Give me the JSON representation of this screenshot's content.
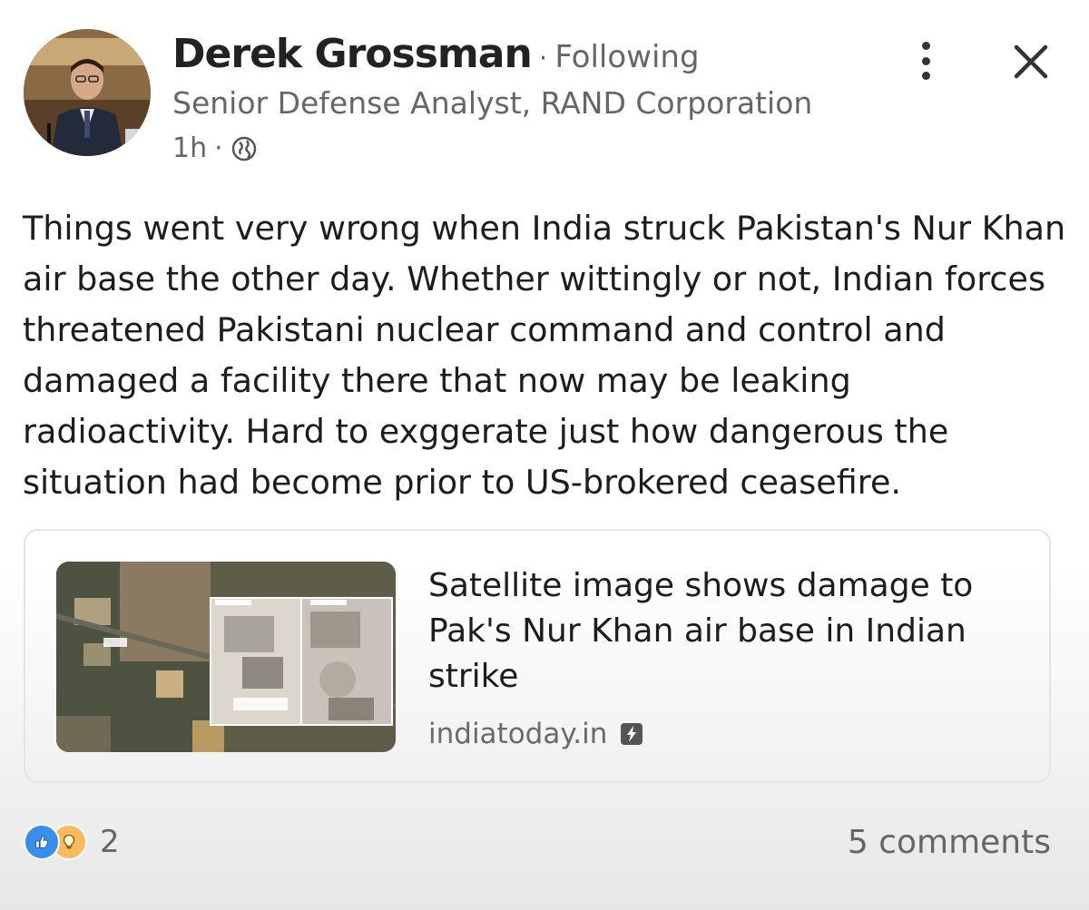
{
  "post": {
    "author": {
      "name": "Derek Grossman",
      "separator": "·",
      "follow_status": "Following",
      "headline": "Senior Defense Analyst, RAND Corporation",
      "time": "1h",
      "visibility_icon": "globe-icon"
    },
    "body": "Things went very wrong when India struck Pakistan's Nur Khan air base the other day. Whether wittingly or not, Indian forces threatened Pakistani nuclear command and control and damaged a facility there that now may be leaking radioactivity. Hard to exggerate just how dangerous the situation had become prior to US-brokered ceasefire.",
    "link": {
      "title": "Satellite image shows damage to Pak's Nur Khan air base in Indian strike",
      "source": "indiatoday.in"
    },
    "social": {
      "reaction_icons": [
        "like-icon",
        "insightful-icon"
      ],
      "reaction_count": "2",
      "comments": "5 comments"
    }
  },
  "colors": {
    "like": "#378fe9",
    "insightful": "#f5bb5c",
    "secondary_text": "#666666"
  }
}
